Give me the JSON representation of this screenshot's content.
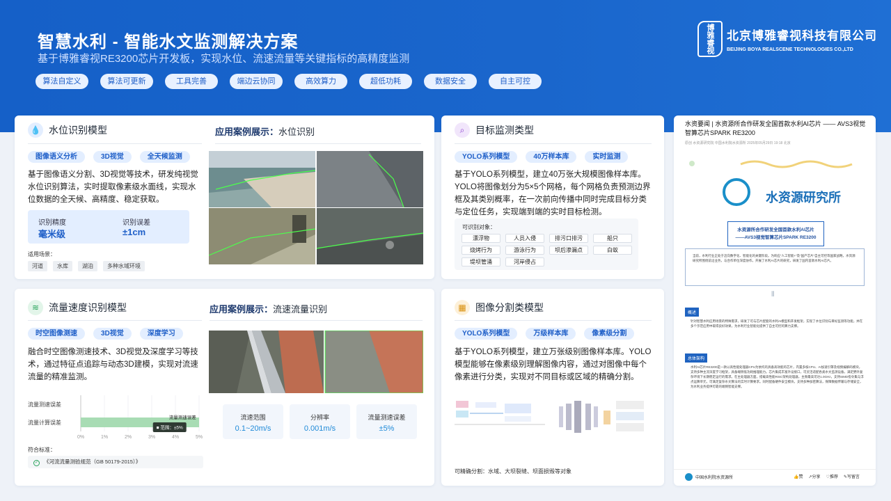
{
  "header": {
    "title": "智慧水利 - 智能水文监测解决方案",
    "subtitle": "基于博雅睿视RE3200芯片开发板，实现水位、流速流量等关键指标的高精度监测",
    "tags": [
      "算法自定义",
      "算法可更新",
      "工具完善",
      "端边云协同",
      "高效算力",
      "超低功耗",
      "数据安全",
      "自主可控"
    ]
  },
  "logo": {
    "mark": "博雅睿视",
    "name_cn": "北京博雅睿视科技有限公司",
    "name_en": "BEIJING BOYA REALSCENE TECHNOLOGIES CO.,LTD"
  },
  "water_level": {
    "title": "水位识别模型",
    "pills": [
      "图像语义分析",
      "3D视觉",
      "全天候监测"
    ],
    "desc": "基于图像语义分割、3D视觉等技术，研发纯视觉水位识别算法，实时提取像素级水面线，实现水位数据的全天候、高精度、稳定获取。",
    "metric1_label": "识别精度",
    "metric1_value": "毫米级",
    "metric2_label": "识别误差",
    "metric2_value": "±1cm",
    "scenes_label": "适用场景：",
    "scenes": [
      "河道",
      "水库",
      "湖泊",
      "多种水域环境"
    ],
    "case_prefix": "应用案例展示：",
    "case_title": "水位识别"
  },
  "target": {
    "title": "目标监测类型",
    "pills": [
      "YOLO系列模型",
      "40万样本库",
      "实时监测"
    ],
    "desc": "基于YOLO系列模型，建立40万张大规模图像样本库。YOLO将图像划分为5×5个网格，每个网格负责预测边界框及其类别概率，在一次前向传播中同时完成目标分类与定位任务，实现端到端的实时目标检测。",
    "objects_label": "可识别对象：",
    "objects": [
      "漂浮物",
      "人员入侵",
      "排污口排污",
      "船只",
      "烧烤行为",
      "游泳行为",
      "坝后渗漏点",
      "白蚁",
      "堤坝管涌",
      "河岸侵占"
    ]
  },
  "flow": {
    "title": "流量速度识别模型",
    "pills": [
      "时空图像测速",
      "3D视觉",
      "深度学习"
    ],
    "desc": "融合时空图像测速技术、3D视觉及深度学习等技术，通过特征点追踪与动态3D建模，实现对流速流量的精准监测。",
    "case_prefix": "应用案例展示：",
    "case_title": "流速流量识别",
    "standard_label": "符合标准：",
    "standard": "《河流流量测验规范（GB 50179-2015）》",
    "stats": [
      {
        "label": "流速范围",
        "value": "0.1~20m/s"
      },
      {
        "label": "分辨率",
        "value": "0.001m/s"
      },
      {
        "label": "流量测速误差",
        "value": "±5%"
      }
    ]
  },
  "chart_data": {
    "type": "bar",
    "categories": [
      "流量测速误差",
      "流量计算误差"
    ],
    "values": [
      0,
      5
    ],
    "xlim": [
      0,
      5
    ],
    "xticks": [
      "0%",
      "1%",
      "2%",
      "3%",
      "4%",
      "5%"
    ],
    "annotation_label": "流量测速误差",
    "tooltip": "范围：±5%",
    "color": "#a8dcb4"
  },
  "segmentation": {
    "title": "图像分割类模型",
    "pills": [
      "YOLO系列模型",
      "万级样本库",
      "像素级分割"
    ],
    "desc": "基于YOLO系列模型，建立万张级别图像样本库。YOLO模型能够在像素级别理解图像内容，通过对图像中每个像素进行分类，实现对不同目标或区域的精确分割。",
    "caption": "可精确分割：水域、大坝裂缝、坝面损毁等对象"
  },
  "article": {
    "headline": "水资要闻 | 水资源所合作研发全国首款水利AI芯片 —— AVS3视觉智算芯片SPARK RE3200",
    "meta": "原创 水资源研究院 中国水利院水资源所 2025年05月29日 19:18 北京",
    "org_name": "水资源研究所",
    "banner_line1": "水资源所合作研发全国首款水利AI芯片",
    "banner_line2": "——AVS3视觉智算芯片SPARK RE3200",
    "section1": "概述",
    "section2": "总体架构",
    "footer_account": "中国水利院水资源所",
    "actions": [
      "赞",
      "分享",
      "推荐",
      "写留言"
    ]
  }
}
